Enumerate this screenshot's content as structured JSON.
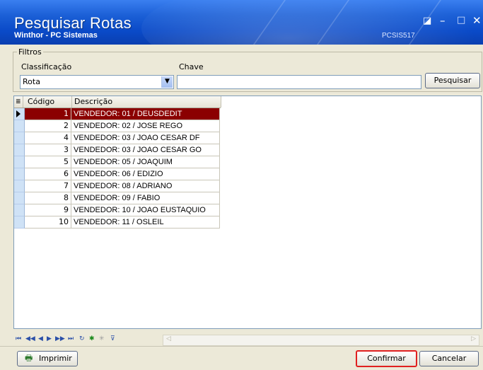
{
  "window": {
    "title": "Pesquisar Rotas",
    "subtitle": "Winthor - PC Sistemas",
    "code": "PCSIS517",
    "controls": [
      "◪",
      "–",
      "□",
      "✕"
    ]
  },
  "filters": {
    "group_label": "Filtros",
    "classificacao_label": "Classificação",
    "classificacao_value": "Rota",
    "chave_label": "Chave",
    "chave_value": "",
    "search_button": "Pesquisar"
  },
  "grid": {
    "columns": [
      "Código",
      "Descrição"
    ],
    "rows": [
      {
        "codigo": "1",
        "descricao": "VENDEDOR: 01 / DEUSDEDIT",
        "selected": true
      },
      {
        "codigo": "2",
        "descricao": "VENDEDOR: 02 / JOSE REGO"
      },
      {
        "codigo": "4",
        "descricao": "VENDEDOR: 03 / JOAO CESAR DF"
      },
      {
        "codigo": "3",
        "descricao": "VENDEDOR: 03 / JOAO CESAR GO"
      },
      {
        "codigo": "5",
        "descricao": "VENDEDOR: 05 / JOAQUIM"
      },
      {
        "codigo": "6",
        "descricao": "VENDEDOR: 06 / EDIZIO"
      },
      {
        "codigo": "7",
        "descricao": "VENDEDOR: 08 / ADRIANO"
      },
      {
        "codigo": "8",
        "descricao": "VENDEDOR: 09 / FABIO"
      },
      {
        "codigo": "9",
        "descricao": "VENDEDOR: 10 / JOAO EUSTAQUIO"
      },
      {
        "codigo": "10",
        "descricao": "VENDEDOR: 11 / OSLEIL"
      }
    ],
    "selected_color": "#8b0000"
  },
  "navigator": {
    "icons": [
      "first-page-icon",
      "prev-page-icon",
      "prev-record-icon",
      "next-record-icon",
      "next-page-icon",
      "last-page-icon",
      "refresh-icon",
      "insert-icon",
      "clear-icon",
      "filter-icon"
    ]
  },
  "footer": {
    "print_button": "Imprimir",
    "confirm_button": "Confirmar",
    "cancel_button": "Cancelar",
    "confirm_highlight_color": "#e02020"
  }
}
